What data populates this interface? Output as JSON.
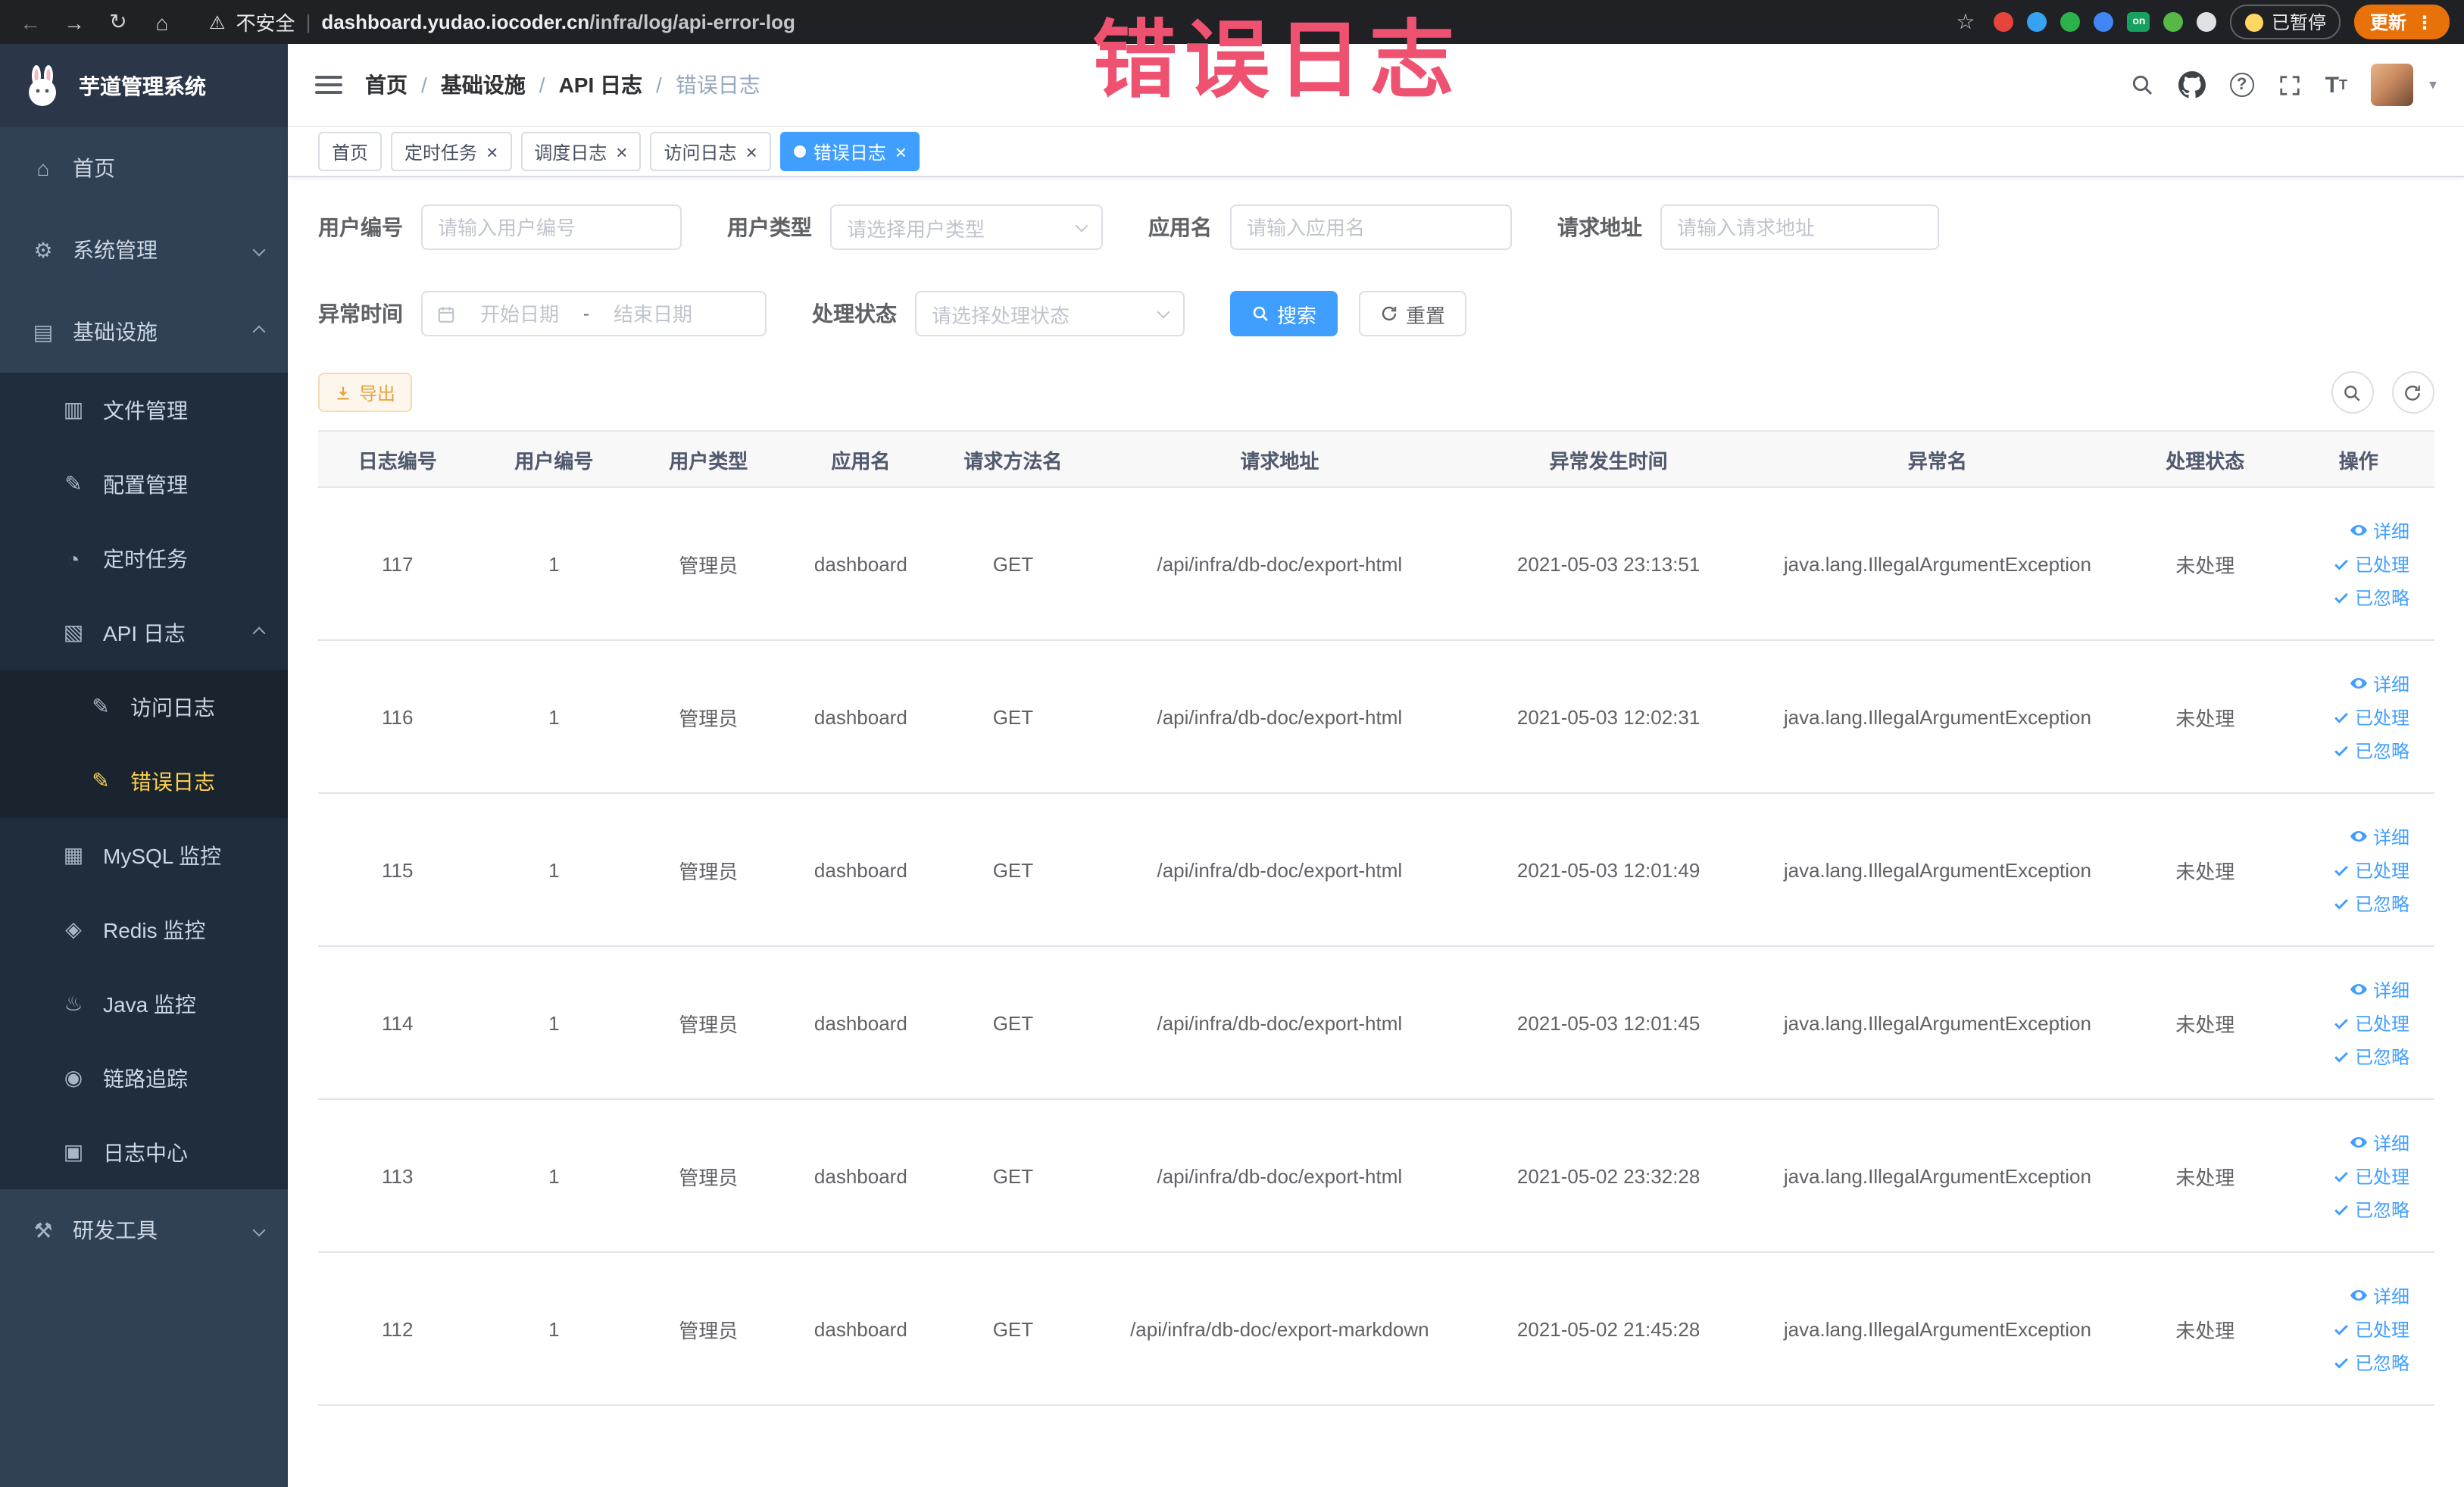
{
  "browser": {
    "security_label": "不安全",
    "url_host": "dashboard.yudao.iocoder.cn",
    "url_path": "/infra/log/api-error-log",
    "paused_badge": "已暂停",
    "update_button": "更新",
    "extensions": [
      {
        "name": "extension-icon-red",
        "color": "#e5453a"
      },
      {
        "name": "extension-icon-blue-drop",
        "color": "#35a3f1"
      },
      {
        "name": "extension-icon-green-circle",
        "color": "#2bb24c"
      },
      {
        "name": "extension-icon-blue-grid",
        "color": "#4285f4"
      },
      {
        "name": "extension-icon-on-badge",
        "color": "#17a05e",
        "text": "on"
      },
      {
        "name": "extension-icon-green-leaf",
        "color": "#57b846"
      },
      {
        "name": "extension-icon-light",
        "color": "#dfe1e5"
      }
    ]
  },
  "annotation": {
    "text": "错误日志"
  },
  "sidebar": {
    "logo_title": "芋道管理系统",
    "items": [
      {
        "name": "home",
        "label": "首页",
        "icon": "home-icon",
        "depth": 0
      },
      {
        "name": "system",
        "label": "系统管理",
        "icon": "gear-icon",
        "depth": 0,
        "arrow": "down"
      },
      {
        "name": "infra",
        "label": "基础设施",
        "icon": "infra-icon",
        "depth": 0,
        "arrow": "up"
      },
      {
        "name": "file",
        "label": "文件管理",
        "icon": "folder-icon",
        "depth": 1
      },
      {
        "name": "config",
        "label": "配置管理",
        "icon": "config-icon",
        "depth": 1
      },
      {
        "name": "job",
        "label": "定时任务",
        "icon": "timer-icon",
        "depth": 1
      },
      {
        "name": "api-log",
        "label": "API 日志",
        "icon": "api-log-icon",
        "depth": 1,
        "arrow": "up"
      },
      {
        "name": "access-log",
        "label": "访问日志",
        "icon": "access-log-icon",
        "depth": 2
      },
      {
        "name": "error-log",
        "label": "错误日志",
        "icon": "error-log-icon",
        "depth": 2,
        "active": true
      },
      {
        "name": "mysql",
        "label": "MySQL 监控",
        "icon": "mysql-icon",
        "depth": 1
      },
      {
        "name": "redis",
        "label": "Redis 监控",
        "icon": "redis-icon",
        "depth": 1
      },
      {
        "name": "java",
        "label": "Java 监控",
        "icon": "java-icon",
        "depth": 1
      },
      {
        "name": "trace",
        "label": "链路追踪",
        "icon": "trace-icon",
        "depth": 1
      },
      {
        "name": "log-center",
        "label": "日志中心",
        "icon": "log-center-icon",
        "depth": 1
      },
      {
        "name": "dev-tools",
        "label": "研发工具",
        "icon": "tools-icon",
        "depth": 0,
        "arrow": "down"
      }
    ]
  },
  "header": {
    "breadcrumb": [
      "首页",
      "基础设施",
      "API 日志",
      "错误日志"
    ]
  },
  "tabs": [
    {
      "name": "home",
      "label": "首页",
      "closable": false,
      "active": false
    },
    {
      "name": "job",
      "label": "定时任务",
      "closable": true,
      "active": false
    },
    {
      "name": "job-log",
      "label": "调度日志",
      "closable": true,
      "active": false
    },
    {
      "name": "access-log",
      "label": "访问日志",
      "closable": true,
      "active": false
    },
    {
      "name": "error-log",
      "label": "错误日志",
      "closable": true,
      "active": true
    }
  ],
  "filters": {
    "user_id": {
      "label": "用户编号",
      "placeholder": "请输入用户编号"
    },
    "user_type": {
      "label": "用户类型",
      "placeholder": "请选择用户类型"
    },
    "app_name": {
      "label": "应用名",
      "placeholder": "请输入应用名"
    },
    "request_url": {
      "label": "请求地址",
      "placeholder": "请输入请求地址"
    },
    "exception_time": {
      "label": "异常时间",
      "start_placeholder": "开始日期",
      "separator": "-",
      "end_placeholder": "结束日期"
    },
    "process_status": {
      "label": "处理状态",
      "placeholder": "请选择处理状态"
    },
    "search_button": "搜索",
    "reset_button": "重置"
  },
  "toolbar": {
    "export_button": "导出"
  },
  "table": {
    "columns": [
      "日志编号",
      "用户编号",
      "用户类型",
      "应用名",
      "请求方法名",
      "请求地址",
      "异常发生时间",
      "异常名",
      "处理状态",
      "操作"
    ],
    "row_actions": [
      "详细",
      "已处理",
      "已忽略"
    ],
    "rows": [
      {
        "log_id": "117",
        "user_id": "1",
        "user_type": "管理员",
        "app_name": "dashboard",
        "method": "GET",
        "url": "/api/infra/db-doc/export-html",
        "time": "2021-05-03 23:13:51",
        "exception": "java.lang.IllegalArgumentException",
        "status": "未处理"
      },
      {
        "log_id": "116",
        "user_id": "1",
        "user_type": "管理员",
        "app_name": "dashboard",
        "method": "GET",
        "url": "/api/infra/db-doc/export-html",
        "time": "2021-05-03 12:02:31",
        "exception": "java.lang.IllegalArgumentException",
        "status": "未处理"
      },
      {
        "log_id": "115",
        "user_id": "1",
        "user_type": "管理员",
        "app_name": "dashboard",
        "method": "GET",
        "url": "/api/infra/db-doc/export-html",
        "time": "2021-05-03 12:01:49",
        "exception": "java.lang.IllegalArgumentException",
        "status": "未处理"
      },
      {
        "log_id": "114",
        "user_id": "1",
        "user_type": "管理员",
        "app_name": "dashboard",
        "method": "GET",
        "url": "/api/infra/db-doc/export-html",
        "time": "2021-05-03 12:01:45",
        "exception": "java.lang.IllegalArgumentException",
        "status": "未处理"
      },
      {
        "log_id": "113",
        "user_id": "1",
        "user_type": "管理员",
        "app_name": "dashboard",
        "method": "GET",
        "url": "/api/infra/db-doc/export-html",
        "time": "2021-05-02 23:32:28",
        "exception": "java.lang.IllegalArgumentException",
        "status": "未处理"
      },
      {
        "log_id": "112",
        "user_id": "1",
        "user_type": "管理员",
        "app_name": "dashboard",
        "method": "GET",
        "url": "/api/infra/db-doc/export-markdown",
        "time": "2021-05-02 21:45:28",
        "exception": "java.lang.IllegalArgumentException",
        "status": "未处理"
      }
    ]
  }
}
